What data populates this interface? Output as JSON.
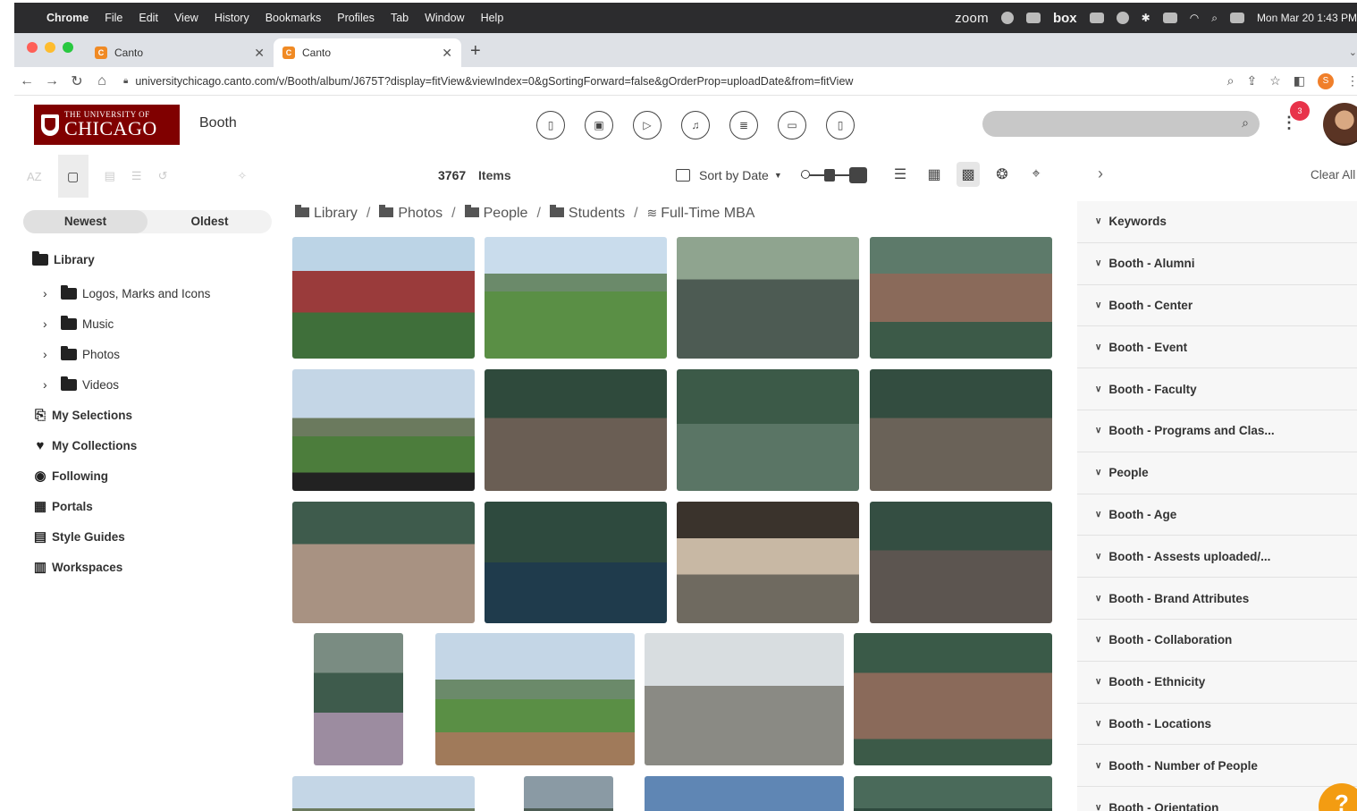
{
  "menubar": {
    "app": "Chrome",
    "items": [
      "File",
      "Edit",
      "View",
      "History",
      "Bookmarks",
      "Profiles",
      "Tab",
      "Window",
      "Help"
    ],
    "zoom": "zoom",
    "box": "box",
    "clock": "Mon Mar 20  1:43 PM"
  },
  "tabs": [
    {
      "title": "Canto",
      "active": false
    },
    {
      "title": "Canto",
      "active": true
    }
  ],
  "address": {
    "url": "universitychicago.canto.com/v/Booth/album/J675T?display=fitView&viewIndex=0&gSortingForward=false&gOrderProp=uploadDate&from=fitView"
  },
  "header": {
    "logo_line1": "THE UNIVERSITY OF",
    "logo_line2": "CHICAGO",
    "brand": "Booth",
    "notifications": "3",
    "profile_initial": "S"
  },
  "toolbar": {
    "count": "3767",
    "items_label": "Items",
    "sort_label": "Sort by Date",
    "clear_all": "Clear All"
  },
  "sidebar": {
    "newest": "Newest",
    "oldest": "Oldest",
    "library": "Library",
    "folders": [
      "Logos, Marks and Icons",
      "Music",
      "Photos",
      "Videos"
    ],
    "links": [
      "My Selections",
      "My Collections",
      "Following",
      "Portals",
      "Style Guides",
      "Workspaces"
    ]
  },
  "breadcrumb": [
    "Library",
    "Photos",
    "People",
    "Students",
    "Full-Time MBA"
  ],
  "filters": [
    "Keywords",
    "Booth - Alumni",
    "Booth - Center",
    "Booth - Event",
    "Booth - Faculty",
    "Booth - Programs and Clas...",
    "People",
    "Booth - Age",
    "Booth - Assests uploaded/...",
    "Booth - Brand Attributes",
    "Booth - Collaboration",
    "Booth - Ethnicity",
    "Booth - Locations",
    "Booth - Number of People",
    "Booth - Orientation"
  ],
  "colors": {
    "uchicago_maroon": "#800000",
    "notification": "#e8334a",
    "help": "#f39c12",
    "menubar": "#2c2c2e"
  }
}
